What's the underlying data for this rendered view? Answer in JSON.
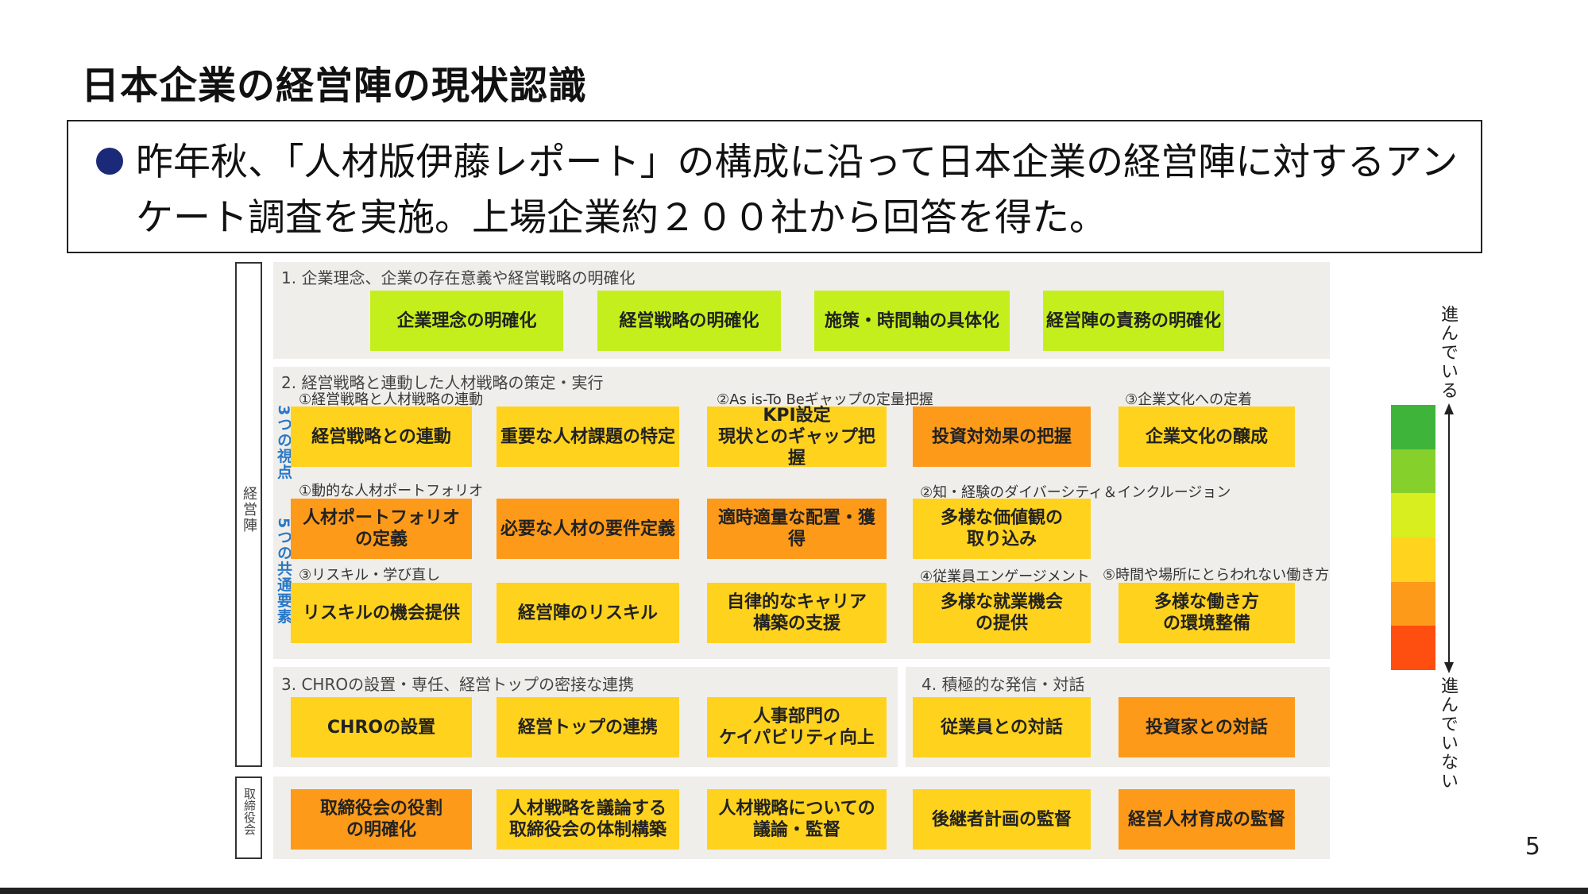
{
  "title": "日本企業の経営陣の現状認識",
  "bullet": "昨年秋、「人材版伊藤レポート」の構成に沿って日本企業の経営陣に対するアンケート調査を実施。上場企業約２００社から回答を得た。",
  "left_labels": {
    "management": "経営陣",
    "board": "取締役会"
  },
  "side_labels": {
    "three": "3つの視点",
    "five": "5つの共通要素"
  },
  "sections": {
    "s1": "1. 企業理念、企業の存在意義や経営戦略の明確化",
    "s2": "2. 経営戦略と連動した人材戦略の策定・実行",
    "s3": "3. CHROの設置・専任、経営トップの密接な連携",
    "s4": "4. 積極的な発信・対話"
  },
  "sublabels": {
    "p1": "①経営戦略と人材戦略の連動",
    "p2": "②As is-To Beギャップの定量把握",
    "p3": "③企業文化への定着",
    "e1": "①動的な人材ポートフォリオ",
    "e2": "②知・経験のダイバーシティ＆インクルージョン",
    "e3": "③リスキル・学び直し",
    "e4": "④従業員エンゲージメント",
    "e5": "⑤時間や場所にとらわれない働き方"
  },
  "colors": {
    "green": "#c4ef1c",
    "yellow": "#ffd21e",
    "orange": "#fd9a1a",
    "scale": [
      "#3fb43a",
      "#86d02c",
      "#d9ee1e",
      "#ffd31e",
      "#fd9a1a",
      "#fe4e10"
    ]
  },
  "boxes": {
    "b1_1": {
      "label": "企業理念の明確化",
      "level": "green"
    },
    "b1_2": {
      "label": "経営戦略の明確化",
      "level": "green"
    },
    "b1_3": {
      "label": "施策・時間軸の具体化",
      "level": "green"
    },
    "b1_4": {
      "label": "経営陣の責務の明確化",
      "level": "green"
    },
    "b2_1": {
      "label": "経営戦略との連動",
      "level": "yellow"
    },
    "b2_2": {
      "label": "重要な人材課題の特定",
      "level": "yellow"
    },
    "b2_3": {
      "label": "KPI設定\n現状とのギャップ把握",
      "level": "yellow"
    },
    "b2_4": {
      "label": "投資対効果の把握",
      "level": "orange"
    },
    "b2_5": {
      "label": "企業文化の醸成",
      "level": "yellow"
    },
    "b3_1": {
      "label": "人材ポートフォリオ\nの定義",
      "level": "orange"
    },
    "b3_2": {
      "label": "必要な人材の要件定義",
      "level": "orange"
    },
    "b3_3": {
      "label": "適時適量な配置・獲得",
      "level": "orange"
    },
    "b3_4": {
      "label": "多様な価値観の\n取り込み",
      "level": "yellow"
    },
    "b4_1": {
      "label": "リスキルの機会提供",
      "level": "yellow"
    },
    "b4_2": {
      "label": "経営陣のリスキル",
      "level": "yellow"
    },
    "b4_3": {
      "label": "自律的なキャリア\n構築の支援",
      "level": "yellow"
    },
    "b4_4": {
      "label": "多様な就業機会\nの提供",
      "level": "yellow"
    },
    "b4_5": {
      "label": "多様な働き方\nの環境整備",
      "level": "yellow"
    },
    "b5_1": {
      "label": "CHROの設置",
      "level": "yellow"
    },
    "b5_2": {
      "label": "経営トップの連携",
      "level": "yellow"
    },
    "b5_3": {
      "label": "人事部門の\nケイパビリティ向上",
      "level": "yellow"
    },
    "b5_4": {
      "label": "従業員との対話",
      "level": "yellow"
    },
    "b5_5": {
      "label": "投資家との対話",
      "level": "orange"
    },
    "b6_1": {
      "label": "取締役会の役割\nの明確化",
      "level": "orange"
    },
    "b6_2": {
      "label": "人材戦略を議論する\n取締役会の体制構築",
      "level": "yellow"
    },
    "b6_3": {
      "label": "人材戦略についての\n議論・監督",
      "level": "yellow"
    },
    "b6_4": {
      "label": "後継者計画の監督",
      "level": "yellow"
    },
    "b6_5": {
      "label": "経営人材育成の監督",
      "level": "orange"
    }
  },
  "legend": {
    "top": "進んでいる",
    "bottom": "進んでいない"
  },
  "page_number": "5"
}
